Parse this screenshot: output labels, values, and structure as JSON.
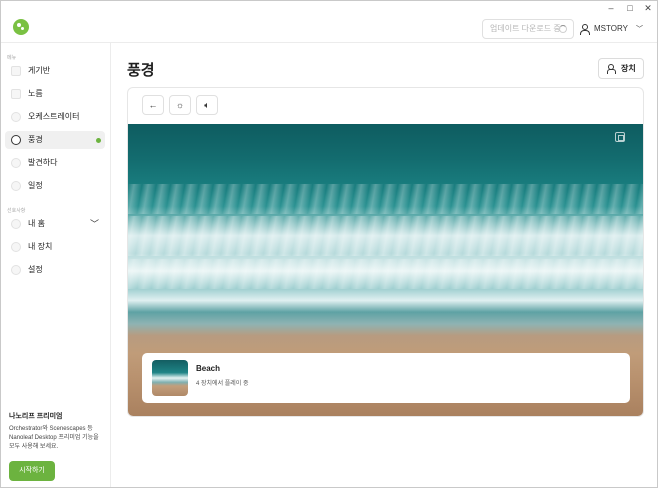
{
  "header": {
    "update_text": "업데이트 다운로드 중",
    "user_name": "MSTORY"
  },
  "sidebar": {
    "section1_label": "메뉴",
    "items": [
      {
        "label": "게기반"
      },
      {
        "label": "노름"
      },
      {
        "label": "오케스트레이터"
      },
      {
        "label": "풍경"
      },
      {
        "label": "발견하다"
      },
      {
        "label": "일정"
      }
    ],
    "section2_label": "선호사항",
    "items2": [
      {
        "label": "내 홈"
      },
      {
        "label": "내 장치"
      },
      {
        "label": "설정"
      }
    ],
    "premium": {
      "title": "나노리프 프리미엄",
      "description": "Orchestrator와 Scenescapes 등 Nanoleaf Desktop 프리미엄 기능을 모두 사용해 보세요.",
      "cta": "시작하기"
    }
  },
  "main": {
    "title": "풍경",
    "devices_button": "장치",
    "now_playing": {
      "title": "Beach",
      "subtitle": "4 장치에서 플레이 중"
    }
  },
  "colors": {
    "accent": "#6cb33f"
  }
}
